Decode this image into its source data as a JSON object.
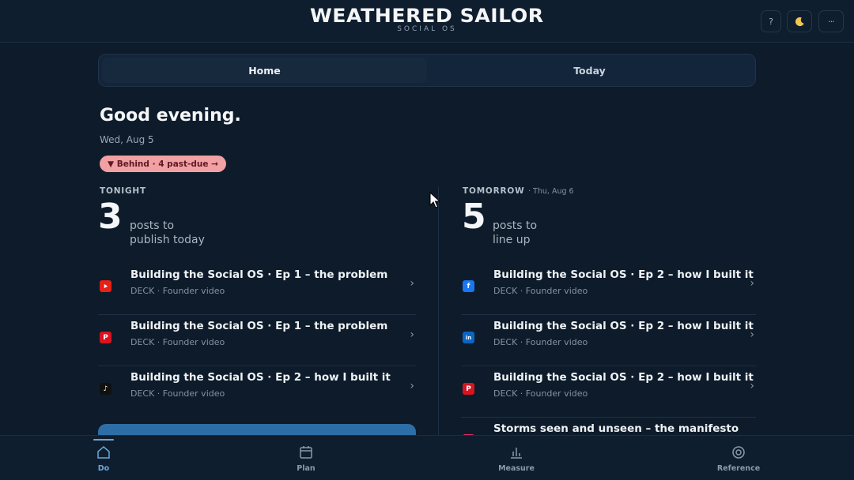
{
  "header": {
    "title": "WEATHERED SAILOR",
    "subtitle": "SOCIAL OS",
    "help_label": "?",
    "theme_icon": "moon-icon",
    "more_label": "···"
  },
  "tabs": [
    {
      "label": "Home",
      "active": true
    },
    {
      "label": "Today",
      "active": false
    }
  ],
  "greeting": "Good evening.",
  "date": "Wed, Aug 5",
  "behind_badge": "▼ Behind · 4 past-due →",
  "tonight": {
    "label": "TONIGHT",
    "count": "3",
    "caption_1": "posts to",
    "caption_2": "publish today",
    "items": [
      {
        "platform": "youtube",
        "title": "Building the Social OS · Ep 1 – the problem",
        "meta": "DECK · Founder video"
      },
      {
        "platform": "pinterest",
        "title": "Building the Social OS · Ep 1 – the problem",
        "meta": "DECK · Founder video"
      },
      {
        "platform": "tiktok",
        "title": "Building the Social OS · Ep 2 – how I built it",
        "meta": "DECK · Founder video"
      }
    ]
  },
  "tomorrow": {
    "label": "TOMORROW",
    "sub_label": "· Thu, Aug 6",
    "count": "5",
    "caption_1": "posts to",
    "caption_2": "line up",
    "items": [
      {
        "platform": "facebook",
        "title": "Building the Social OS · Ep 2 – how I built it",
        "meta": "DECK · Founder video"
      },
      {
        "platform": "linkedin",
        "title": "Building the Social OS · Ep 2 – how I built it",
        "meta": "DECK · Founder video"
      },
      {
        "platform": "pinterest",
        "title": "Building the Social OS · Ep 2 – how I built it",
        "meta": "DECK · Founder video"
      },
      {
        "platform": "instagram",
        "title": "Storms seen and unseen – the manifesto",
        "meta": ""
      }
    ]
  },
  "nav": [
    {
      "label": "Do",
      "icon": "home-icon",
      "active": true
    },
    {
      "label": "Plan",
      "icon": "calendar-icon",
      "active": false
    },
    {
      "label": "Measure",
      "icon": "bar-chart-icon",
      "active": false
    },
    {
      "label": "Reference",
      "icon": "target-icon",
      "active": false
    }
  ],
  "colors": {
    "background": "#0d1b2a",
    "accent": "#6ba7dd",
    "badge": "#f1a0a3",
    "cta": "#2e6ea6",
    "youtube": "#e62117",
    "pinterest": "#d7141f",
    "facebook": "#1877f2",
    "linkedin": "#0a66c2",
    "tiktok": "#111111",
    "instagram": "#e1306c"
  }
}
